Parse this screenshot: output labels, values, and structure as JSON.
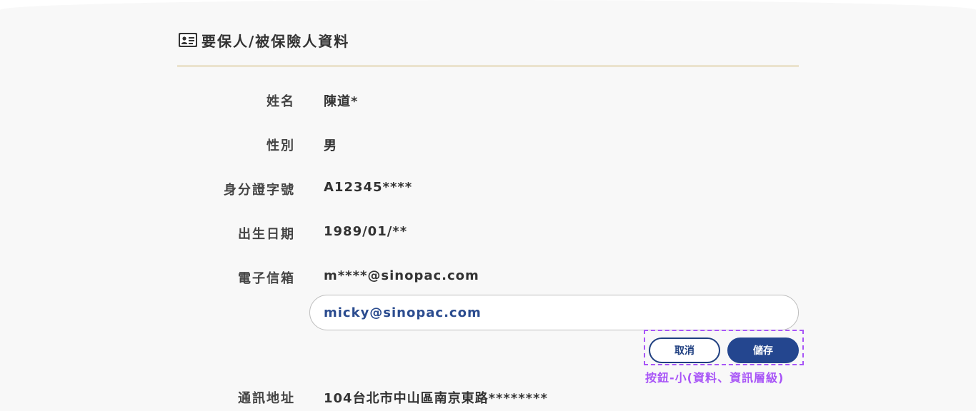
{
  "section": {
    "title": "要保人/被保險人資料",
    "icon": "id-card-icon"
  },
  "fields": {
    "name": {
      "label": "姓名",
      "value": "陳道*"
    },
    "gender": {
      "label": "性別",
      "value": "男"
    },
    "id_number": {
      "label": "身分證字號",
      "value": "A12345****"
    },
    "birth_date": {
      "label": "出生日期",
      "value": "1989/01/**"
    },
    "email": {
      "label": "電子信箱",
      "value": "m****@sinopac.com",
      "input_value": "micky@sinopac.com"
    },
    "address": {
      "label": "通訊地址",
      "value": "104台北市中山區南京東路********"
    }
  },
  "buttons": {
    "cancel_label": "取消",
    "save_label": "儲存"
  },
  "annotation": {
    "label": "按鈕-小(資料、資訊層級)"
  },
  "colors": {
    "accent_line": "#c8a95a",
    "primary": "#24468f",
    "annotation": "#a855f7",
    "background": "#f8f8f8"
  }
}
